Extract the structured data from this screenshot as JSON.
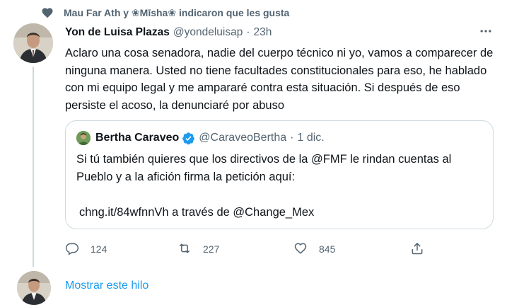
{
  "social_context": {
    "text": "Mau Far Ath y ❀Mīsha❀ indicaron que les gusta",
    "icon": "heart-icon"
  },
  "tweet": {
    "author_name": "Yon de Luisa Plazas",
    "author_handle": "@yondeluisap",
    "separator": "·",
    "time": "23h",
    "text": "Aclaro una cosa senadora, nadie del cuerpo técnico ni yo, vamos a comparecer de ninguna manera. Usted no tiene facultades constitucionales para eso, he hablado con mi equipo legal y me ampararé contra esta situación. Si después de eso persiste el acoso, la denunciaré por abuso"
  },
  "quote": {
    "author_name": "Bertha Caraveo",
    "author_handle": "@CaraveoBertha",
    "separator": "·",
    "time": "1 dic.",
    "text": "Si tú también quieres que los directivos de la @FMF le rindan cuentas al Pueblo y a la afición firma la petición aquí:",
    "link_line": "chng.it/84wfnnVh a través de @Change_Mex",
    "verified_color": "#1d9bf0"
  },
  "actions": {
    "reply_count": "124",
    "retweet_count": "227",
    "like_count": "845"
  },
  "show_thread": {
    "label": "Mostrar este hilo"
  },
  "colors": {
    "text": "#0f1419",
    "secondary": "#536471",
    "accent": "#1d9bf0",
    "border": "#cfd9de"
  }
}
